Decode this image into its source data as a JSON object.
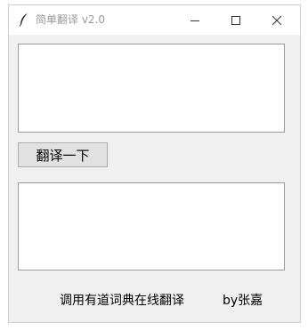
{
  "window": {
    "title": "简单翻译  v2.0",
    "controls": {
      "minimize": "minimize-icon",
      "maximize": "maximize-icon",
      "close": "close-icon"
    }
  },
  "input_area": {
    "value": ""
  },
  "translate_button": {
    "label": "翻译一下"
  },
  "output_area": {
    "value": ""
  },
  "footer": {
    "service_text": "调用有道词典在线翻译",
    "author_text": "by张嘉"
  },
  "colors": {
    "window_bg": "#f0f0f0",
    "titlebar_bg": "#ffffff",
    "title_text": "#9a9a9a",
    "button_bg": "#e1e1e1"
  }
}
